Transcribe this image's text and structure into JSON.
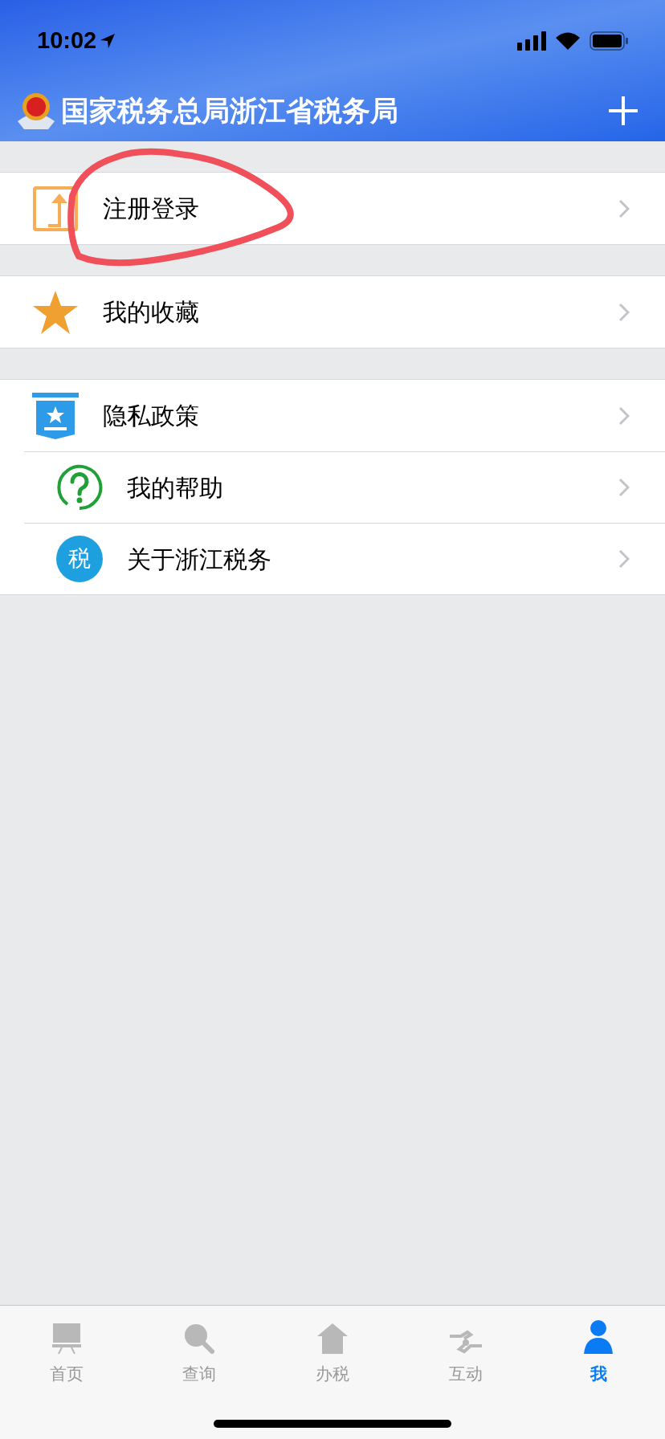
{
  "status_bar": {
    "time": "10:02"
  },
  "header": {
    "title": "国家税务总局浙江省税务局"
  },
  "sections": [
    {
      "items": [
        {
          "kind": "upload",
          "label": "注册登录"
        }
      ]
    },
    {
      "items": [
        {
          "kind": "star",
          "label": "我的收藏"
        }
      ]
    },
    {
      "items": [
        {
          "kind": "policy",
          "label": "隐私政策"
        },
        {
          "kind": "help",
          "label": "我的帮助"
        },
        {
          "kind": "tax",
          "label": "关于浙江税务",
          "badge": "税"
        }
      ]
    }
  ],
  "annotation": {
    "kind": "circle",
    "color": "#f0505a"
  },
  "tabs": [
    {
      "kind": "board",
      "label": "首页",
      "selected": false
    },
    {
      "kind": "search",
      "label": "查询",
      "selected": false
    },
    {
      "kind": "house",
      "label": "办税",
      "selected": false
    },
    {
      "kind": "handshake",
      "label": "互动",
      "selected": false
    },
    {
      "kind": "person",
      "label": "我",
      "selected": true
    }
  ]
}
